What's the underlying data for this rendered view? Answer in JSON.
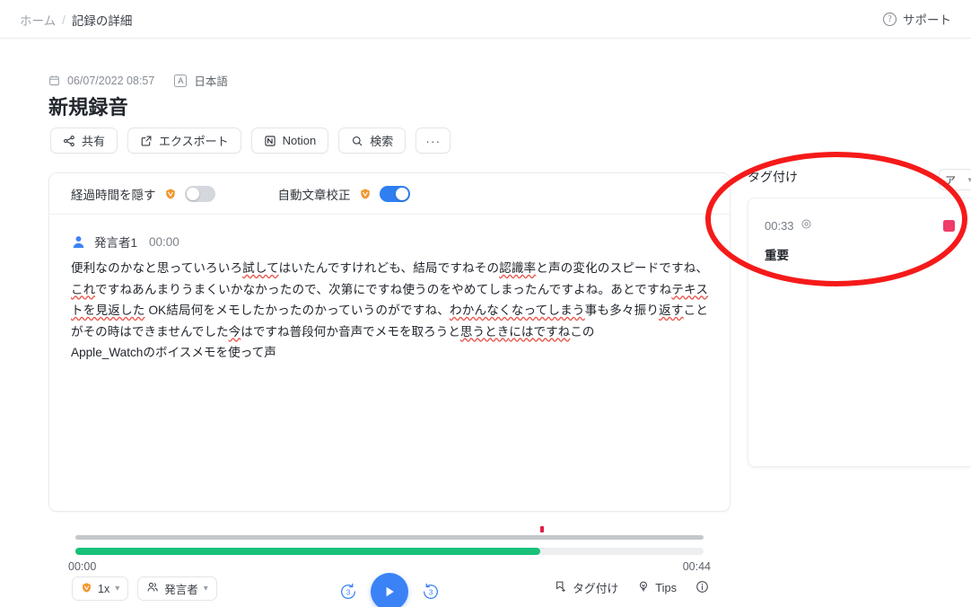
{
  "topbar": {
    "breadcrumb_home": "ホーム",
    "breadcrumb_sep": "/",
    "breadcrumb_current": "記録の詳細",
    "support_label": "サポート",
    "support_icon": "question-circle-icon"
  },
  "record": {
    "datetime": "06/07/2022 08:57",
    "calendar_icon": "calendar-icon",
    "language_badge": "A",
    "language": "日本語",
    "title": "新規録音"
  },
  "actions": [
    {
      "id": "share",
      "label": "共有",
      "icon": "share-icon"
    },
    {
      "id": "export",
      "label": "エクスポート",
      "icon": "export-icon"
    },
    {
      "id": "notion",
      "label": "Notion",
      "icon": "notion-icon"
    },
    {
      "id": "search",
      "label": "検索",
      "icon": "search-icon"
    },
    {
      "id": "more",
      "label": "···",
      "icon": "more-horizontal-icon"
    }
  ],
  "toggles": [
    {
      "id": "hide-elapsed",
      "label": "経過時間を隠す",
      "badge": "pro-badge-icon",
      "on": false
    },
    {
      "id": "auto-proofread",
      "label": "自動文章校正",
      "badge": "pro-badge-icon",
      "on": true
    }
  ],
  "transcript": {
    "speaker_icon": "person-icon",
    "speaker_name": "発言者1",
    "speaker_time": "00:00",
    "text_part1": "便利なのかなと思っていろいろ",
    "text_sq1": "試して",
    "text_part2": "はいたんですけれども、結局ですねその",
    "text_sq2": "認識率",
    "text_part3": "と声の変化のスピードですね、",
    "text_sq3": "これ",
    "text_part4": "ですねあんまりうまくいかなかったので、次第にですね使うのをやめてしまったんですよね。あとですね",
    "text_sq4": "テキストを見返した",
    "text_part5": " OK結局何をメモしたかったのかっていうのがですね、",
    "text_sq5": "わかんなくなってしまう",
    "text_part6": "事も多々振り",
    "text_sq6": "返す",
    "text_part7": "ことがその時はできませんでした",
    "text_sq7": "今",
    "text_part8": "はですね普段何か音声でメモを取ろうと",
    "text_sq8": "思うとき",
    "text_sq9": "にはですね",
    "text_part9": "この",
    "text_part10": "Apple_Watchのボイスメモを使って声"
  },
  "player": {
    "current_time": "00:00",
    "total_time": "00:44",
    "progress_percent": 74,
    "marker_percent": 74,
    "speed_label": "1x",
    "speed_badge": "pro-badge-icon",
    "speaker_filter_label": "発言者",
    "speaker_filter_icon": "people-icon",
    "rewind_label": "3",
    "forward_label": "3",
    "play_icon": "play-icon",
    "right_items": [
      {
        "id": "add-tag",
        "label": "タグ付け",
        "icon": "tag-add-icon"
      },
      {
        "id": "tips",
        "label": "Tips",
        "icon": "tips-icon"
      },
      {
        "id": "info",
        "label": "",
        "icon": "info-icon"
      }
    ]
  },
  "tagpanel": {
    "title": "タグ付け",
    "select_value": "ア",
    "select_chevron": "chevron-down-icon",
    "items": [
      {
        "time": "00:33",
        "time_icon": "target-icon",
        "color": "#ef3b68",
        "label": "重要"
      }
    ]
  },
  "annotation": {
    "shape": "ellipse",
    "color": "#f51a1a",
    "stroke_width": 6
  }
}
